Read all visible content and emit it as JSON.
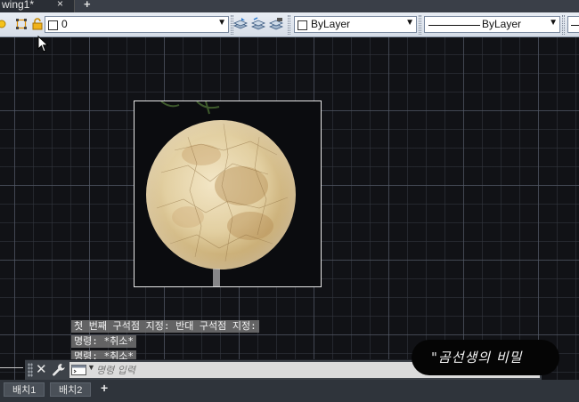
{
  "file_tabs": {
    "active_label": "wing1*",
    "close_symbol": "×",
    "add_symbol": "+"
  },
  "toolbar": {
    "layer": {
      "value": "0",
      "state_icons": [
        "sun-icon",
        "freeze-viewport-icon",
        "lock-icon"
      ]
    },
    "layer_buttons": [
      "make-current-layer-icon",
      "match-layer-icon",
      "previous-layer-icon"
    ],
    "color": {
      "value": "ByLayer"
    },
    "linetype": {
      "value": "ByLayer"
    }
  },
  "canvas": {
    "image_content": "full moon photograph"
  },
  "command_history": [
    "첫 번째 구석점 지정: 반대 구석점 지정:",
    "명령: *취소*",
    "명령: *취소*"
  ],
  "command_line": {
    "close_symbol": "✕",
    "placeholder": "명령 입력"
  },
  "watermark": {
    "text": "\"곰선생의 비밀"
  },
  "layout_tabs": {
    "tabs": [
      "배치1",
      "배치2"
    ],
    "add_symbol": "+"
  },
  "colors": {
    "canvas_bg": "#111216",
    "toolbar_bg": "#dfe5ee",
    "grid_major": "#5a606e",
    "command_history_bg": "#787878",
    "command_field_bg": "#dcdcdc"
  }
}
